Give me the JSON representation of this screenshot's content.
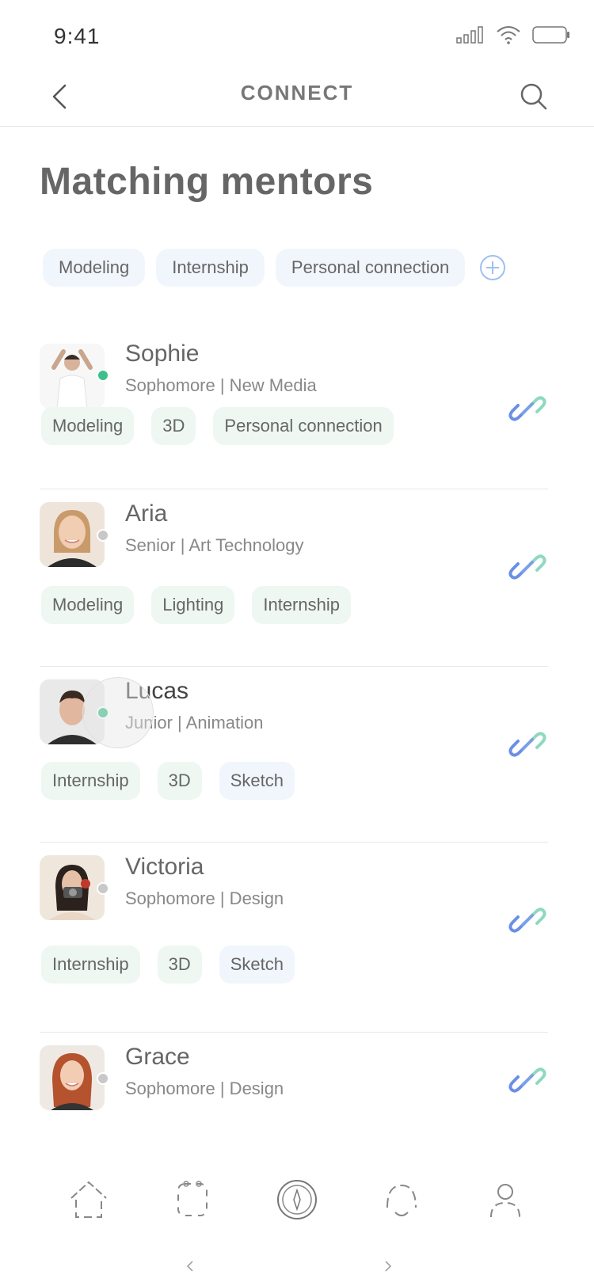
{
  "status_bar": {
    "time": "9:41"
  },
  "header": {
    "title": "CONNECT"
  },
  "section_title": "Matching mentors",
  "filters": [
    {
      "label": "Modeling"
    },
    {
      "label": "Internship"
    },
    {
      "label": "Personal connection"
    }
  ],
  "mentors": [
    {
      "name": "Sophie",
      "subtitle": "Sophomore | New Media",
      "online": true,
      "tags": [
        {
          "label": "Modeling",
          "style": "green"
        },
        {
          "label": "3D",
          "style": "green"
        },
        {
          "label": "Personal connection",
          "style": "green"
        }
      ]
    },
    {
      "name": "Aria",
      "subtitle": "Senior | Art Technology",
      "online": false,
      "tags": [
        {
          "label": "Modeling",
          "style": "green"
        },
        {
          "label": "Lighting",
          "style": "green"
        },
        {
          "label": "Internship",
          "style": "green"
        }
      ]
    },
    {
      "name": "Lucas",
      "subtitle": "Junior | Animation",
      "online": true,
      "tags": [
        {
          "label": "Internship",
          "style": "green"
        },
        {
          "label": "3D",
          "style": "green"
        },
        {
          "label": "Sketch",
          "style": "blue"
        }
      ]
    },
    {
      "name": "Victoria",
      "subtitle": "Sophomore | Design",
      "online": false,
      "tags": [
        {
          "label": "Internship",
          "style": "green"
        },
        {
          "label": "3D",
          "style": "green"
        },
        {
          "label": "Sketch",
          "style": "blue"
        }
      ]
    },
    {
      "name": "Grace",
      "subtitle": "Sophomore | Design",
      "online": false,
      "tags": []
    }
  ],
  "colors": {
    "online": "#3cc08a",
    "offline": "#c8c8c8",
    "chip_blue_bg": "#f1f6fd",
    "chip_green_bg": "#eef7f2",
    "link_blue": "#6b8fe6",
    "link_green": "#8fd8c2",
    "add_icon": "#9fc0f2"
  },
  "icons": {
    "status": [
      "signal-icon",
      "wifi-icon",
      "battery-icon"
    ],
    "tabbar": [
      "home-icon",
      "discover-icon",
      "compass-icon",
      "connect-icon",
      "profile-icon"
    ]
  }
}
